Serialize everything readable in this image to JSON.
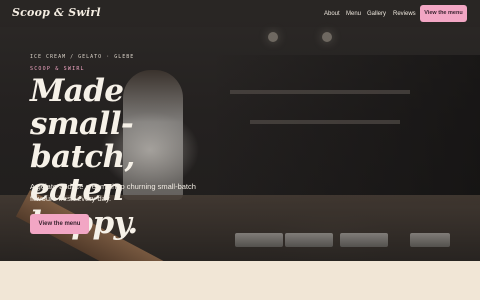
{
  "nav": {
    "logo": "Scoop & Swirl",
    "links": [
      "About",
      "Menu",
      "Gallery",
      "Reviews"
    ],
    "cta": "View the menu"
  },
  "hero": {
    "eyebrow": "ICE CREAM / GELATO · GLEBE",
    "brand": "SCOOP & SWIRL",
    "headline": "Made small-batch, eaten happy.",
    "subtext": "A gelato and ice cream shop churning small-batch flavours fresh every day.",
    "cta": "View the menu"
  },
  "colors": {
    "accent": "#f2a6c4",
    "page_background": "#f1e6d6",
    "hero_overlay": "#242120"
  }
}
